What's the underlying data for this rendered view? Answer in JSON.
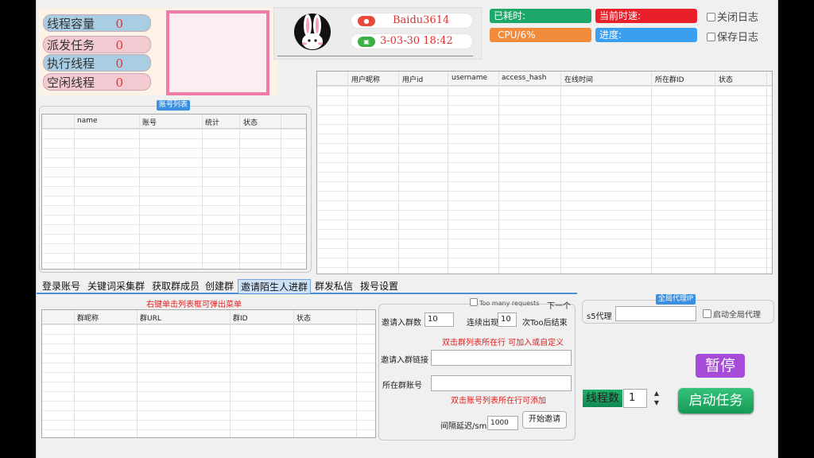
{
  "thread_stats": [
    {
      "label": "线程容量",
      "value": "0",
      "color": "#a9cde2"
    },
    {
      "label": "派发任务",
      "value": "0",
      "color": "#f3c9d2"
    },
    {
      "label": "执行线程",
      "value": "0",
      "color": "#a9cde2"
    },
    {
      "label": "空闲线程",
      "value": "0",
      "color": "#f3c9d2"
    }
  ],
  "profile": {
    "name": "Baidu3614",
    "date": "3-03-30 18:42"
  },
  "status": {
    "elapsed": "已耗时:",
    "speed": "当前时速:",
    "cpu": "CPU/6%",
    "progress": "进度:"
  },
  "options": {
    "close_log": "关闭日志",
    "save_log": "保存日志"
  },
  "accounts": {
    "title": "账号列表",
    "columns": [
      "name",
      "账号",
      "统计",
      "状态"
    ]
  },
  "members": {
    "columns": [
      "用户昵称",
      "用户id",
      "username",
      "access_hash",
      "在线时间",
      "所在群ID",
      "状态"
    ]
  },
  "tabs": [
    "登录账号",
    "关键词采集群",
    "获取群成员",
    "创建群",
    "邀请陌生人进群",
    "群发私信",
    "拨号设置"
  ],
  "invite": {
    "hint_right_click": "右键单击列表框可弹出菜单",
    "group_columns": [
      "群昵称",
      "群URL",
      "群ID",
      "状态"
    ],
    "too_many_label": "Too many requests",
    "next_label": "下一个",
    "invite_count_label": "邀请入群数",
    "invite_count_value": "10",
    "consecutive_label": "连续出现",
    "consecutive_value": "10",
    "too_end_label": "次Too后结束",
    "double_click_group_hint": "双击群列表所在行 可加入或自定义",
    "invite_link_label": "邀请入群链接",
    "group_account_label": "所在群账号",
    "double_click_account_hint": "双击账号列表所在行可添加",
    "delay_label": "间隔延迟/sm",
    "delay_value": "1000",
    "start_invite": "开始邀请"
  },
  "proxy": {
    "title": "全局代理IP",
    "s5_label": "s5代理",
    "enable_label": "启动全局代理"
  },
  "controls": {
    "pause": "暂停",
    "threads_label": "线程数",
    "threads_value": "1",
    "start_task": "启动任务"
  }
}
